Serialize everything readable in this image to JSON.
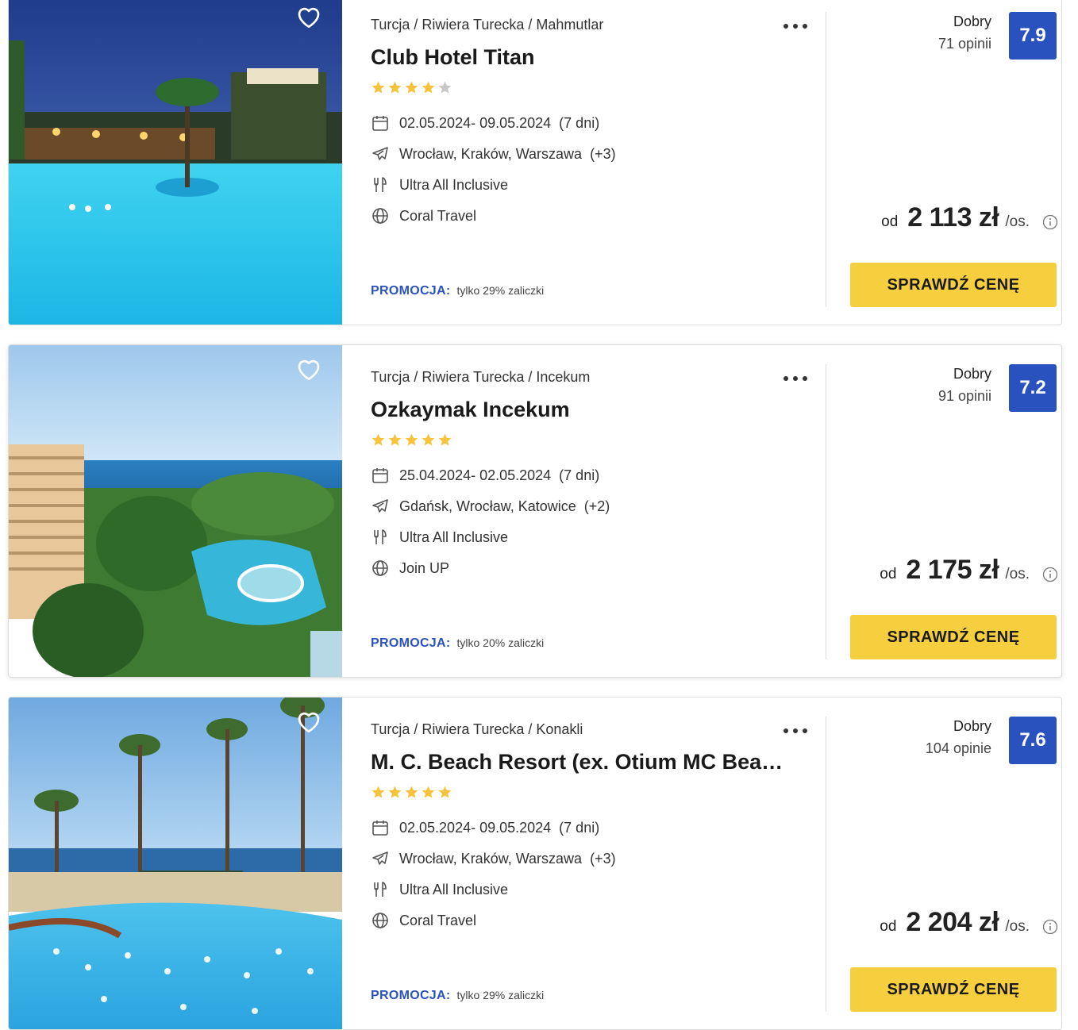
{
  "colors": {
    "accent_blue": "#2a52be",
    "cta_yellow": "#f6cf3e",
    "star_yellow": "#f7c33c",
    "star_grey": "#c8c8c8"
  },
  "offers": [
    {
      "breadcrumb": "Turcja / Riwiera Turecka / Mahmutlar",
      "name": "Club Hotel Titan",
      "stars": 4,
      "dates": "02.05.2024- 09.05.2024",
      "duration": "(7 dni)",
      "departures": "Wrocław, Kraków, Warszawa",
      "departures_more": "(+3)",
      "board": "Ultra All Inclusive",
      "operator": "Coral Travel",
      "promo_label": "PROMOCJA:",
      "promo_text": "tylko 29% zaliczki",
      "rating_label": "Dobry",
      "reviews": "71 opinii",
      "score": "7.9",
      "price_prefix": "od",
      "price": "2 113 zł",
      "price_suffix": "/os.",
      "cta": "SPRAWDŹ CENĘ",
      "photo": "hotel-pool-night"
    },
    {
      "breadcrumb": "Turcja / Riwiera Turecka / Incekum",
      "name": "Ozkaymak Incekum",
      "stars": 5,
      "dates": "25.04.2024- 02.05.2024",
      "duration": "(7 dni)",
      "departures": "Gdańsk, Wrocław, Katowice",
      "departures_more": "(+2)",
      "board": "Ultra All Inclusive",
      "operator": "Join UP",
      "promo_label": "PROMOCJA:",
      "promo_text": "tylko 20% zaliczki",
      "rating_label": "Dobry",
      "reviews": "91 opinii",
      "score": "7.2",
      "price_prefix": "od",
      "price": "2 175 zł",
      "price_suffix": "/os.",
      "cta": "SPRAWDŹ CENĘ",
      "photo": "hotel-coast-pools"
    },
    {
      "breadcrumb": "Turcja / Riwiera Turecka / Konakli",
      "name": "M. C. Beach Resort (ex. Otium MC Beach Resort)",
      "stars": 5,
      "dates": "02.05.2024- 09.05.2024",
      "duration": "(7 dni)",
      "departures": "Wrocław, Kraków, Warszawa",
      "departures_more": "(+3)",
      "board": "Ultra All Inclusive",
      "operator": "Coral Travel",
      "promo_label": "PROMOCJA:",
      "promo_text": "tylko 29% zaliczki",
      "rating_label": "Dobry",
      "reviews": "104 opinie",
      "score": "7.6",
      "price_prefix": "od",
      "price": "2 204 zł",
      "price_suffix": "/os.",
      "cta": "SPRAWDŹ CENĘ",
      "photo": "resort-pool-palms"
    }
  ]
}
